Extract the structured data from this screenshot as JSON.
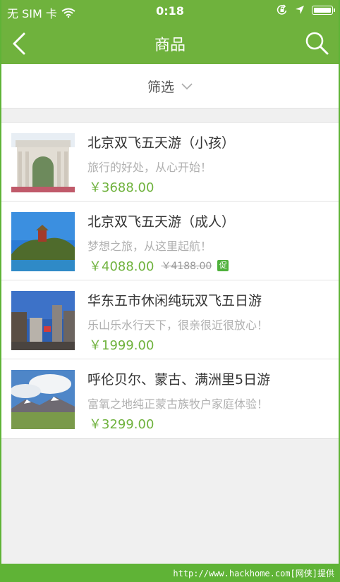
{
  "status_bar": {
    "carrier": "无 SIM 卡",
    "time": "0:18"
  },
  "header": {
    "title": "商品"
  },
  "filter": {
    "label": "筛选"
  },
  "products": [
    {
      "title": "北京双飞五天游（小孩）",
      "subtitle": "旅行的好处，从心开始！",
      "price": "￥3688.00",
      "old_price": "",
      "promo": ""
    },
    {
      "title": "北京双飞五天游（成人）",
      "subtitle": "梦想之旅，从这里起航！",
      "price": "￥4088.00",
      "old_price": "￥4188.00",
      "promo": "促"
    },
    {
      "title": "华东五市休闲纯玩双飞五日游",
      "subtitle": "乐山乐水行天下，很亲很近很放心！",
      "price": "￥1999.00",
      "old_price": "",
      "promo": ""
    },
    {
      "title": "呼伦贝尔、蒙古、满洲里5日游",
      "subtitle": "富氧之地纯正蒙古族牧户家庭体验！",
      "price": "￥3299.00",
      "old_price": "",
      "promo": ""
    }
  ],
  "watermark": "http://www.hackhome.com[网侠]提供",
  "colors": {
    "brand_green": "#6fb23d",
    "price_green": "#6fb23d",
    "frame_green": "#5fb336"
  }
}
